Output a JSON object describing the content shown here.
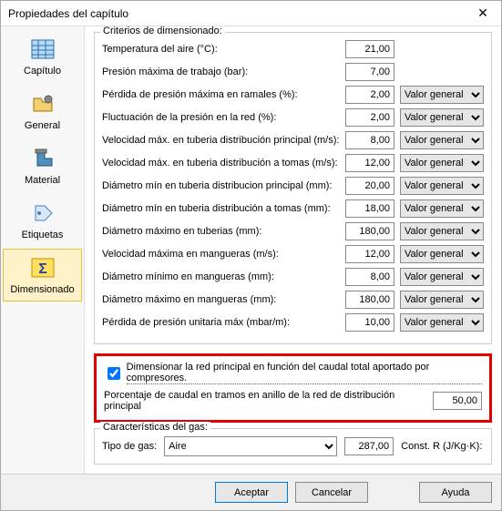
{
  "window": {
    "title": "Propiedades del capítulo"
  },
  "sidebar": {
    "items": [
      {
        "label": "Capítulo"
      },
      {
        "label": "General"
      },
      {
        "label": "Material"
      },
      {
        "label": "Etiquetas"
      },
      {
        "label": "Dimensionado"
      }
    ]
  },
  "criteria": {
    "legend": "Criterios de dimensionado:",
    "generic_option": "Valor general",
    "rows": [
      {
        "label": "Temperatura del aire (°C):",
        "value": "21,00",
        "has_select": false
      },
      {
        "label": "Presión máxima de trabajo (bar):",
        "value": "7,00",
        "has_select": false
      },
      {
        "label": "Pérdida de presión máxima en ramales (%):",
        "value": "2,00",
        "has_select": true
      },
      {
        "label": "Fluctuación de la presión en la red (%):",
        "value": "2,00",
        "has_select": true
      },
      {
        "label": "Velocidad máx. en tuberia distribución principal (m/s):",
        "value": "8,00",
        "has_select": true
      },
      {
        "label": "Velocidad máx. en tuberia distribución a tomas (m/s):",
        "value": "12,00",
        "has_select": true
      },
      {
        "label": "Diámetro mín en tuberia distribucion principal (mm):",
        "value": "20,00",
        "has_select": true
      },
      {
        "label": "Diámetro mín en tuberia distribución a tomas (mm):",
        "value": "18,00",
        "has_select": true
      },
      {
        "label": "Diámetro máximo en tuberias (mm):",
        "value": "180,00",
        "has_select": true
      },
      {
        "label": "Velocidad máxima en mangueras (m/s):",
        "value": "12,00",
        "has_select": true
      },
      {
        "label": "Diámetro mínimo en mangueras (mm):",
        "value": "8,00",
        "has_select": true
      },
      {
        "label": "Diámetro máximo en mangueras (mm):",
        "value": "180,00",
        "has_select": true
      },
      {
        "label": "Pérdida de presión unitaria máx (mbar/m):",
        "value": "10,00",
        "has_select": true
      }
    ]
  },
  "redbox": {
    "checkbox_label": "Dimensionar la red principal en función del caudal total aportado por compresores.",
    "checked": true,
    "pct_label": "Porcentaje de caudal en tramos en anillo de la red de distribución principal",
    "pct_value": "50,00"
  },
  "gas": {
    "legend": "Características del gas:",
    "type_label": "Tipo de gas:",
    "type_value": "Aire",
    "const_value": "287,00",
    "const_label": "Const. R (J/Kg·K):"
  },
  "footer": {
    "accept": "Aceptar",
    "cancel": "Cancelar",
    "help": "Ayuda"
  }
}
